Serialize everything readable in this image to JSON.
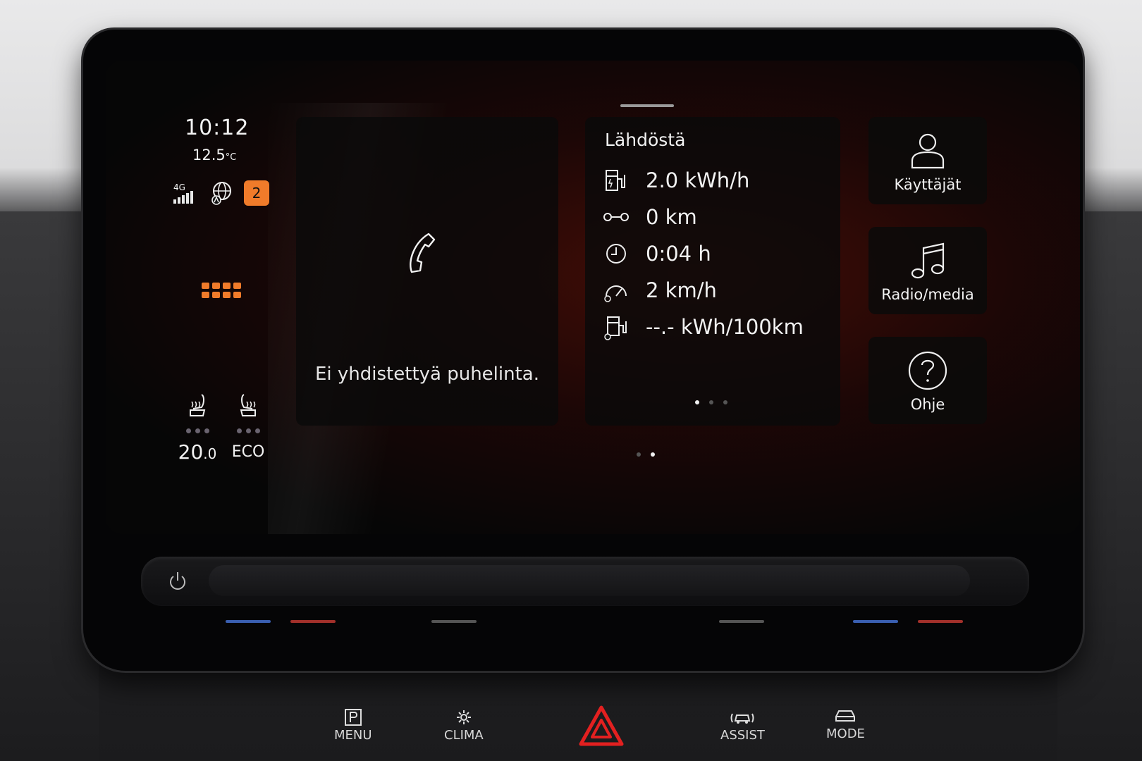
{
  "status": {
    "time": "10:12",
    "temperature": "12.5",
    "temperature_unit": "°C",
    "network": "4G",
    "notification_count": "2"
  },
  "climate": {
    "driver_temp": "20",
    "driver_temp_decimal": ".0",
    "mode": "ECO"
  },
  "phone": {
    "message": "Ei yhdistettyä puhelinta."
  },
  "trip": {
    "title": "Lähdöstä",
    "rows": [
      {
        "icon": "fuel-pump-energy-icon",
        "value": "2.0 kWh/h"
      },
      {
        "icon": "distance-icon",
        "value": "0 km"
      },
      {
        "icon": "clock-icon",
        "value": "0:04 h"
      },
      {
        "icon": "speedometer-icon",
        "value": "2 km/h"
      },
      {
        "icon": "consumption-icon",
        "value": "--.- kWh/100km"
      }
    ]
  },
  "quick_actions": [
    {
      "label": "Käyttäjät",
      "icon": "user-icon"
    },
    {
      "label": "Radio/media",
      "icon": "music-note-icon"
    },
    {
      "label": "Ohje",
      "icon": "help-icon"
    }
  ],
  "hardware_buttons": {
    "menu": "MENU",
    "clima": "CLIMA",
    "assist": "ASSIST",
    "mode": "MODE"
  },
  "colors": {
    "accent": "#f07b2a",
    "glow": "#7a1408"
  }
}
